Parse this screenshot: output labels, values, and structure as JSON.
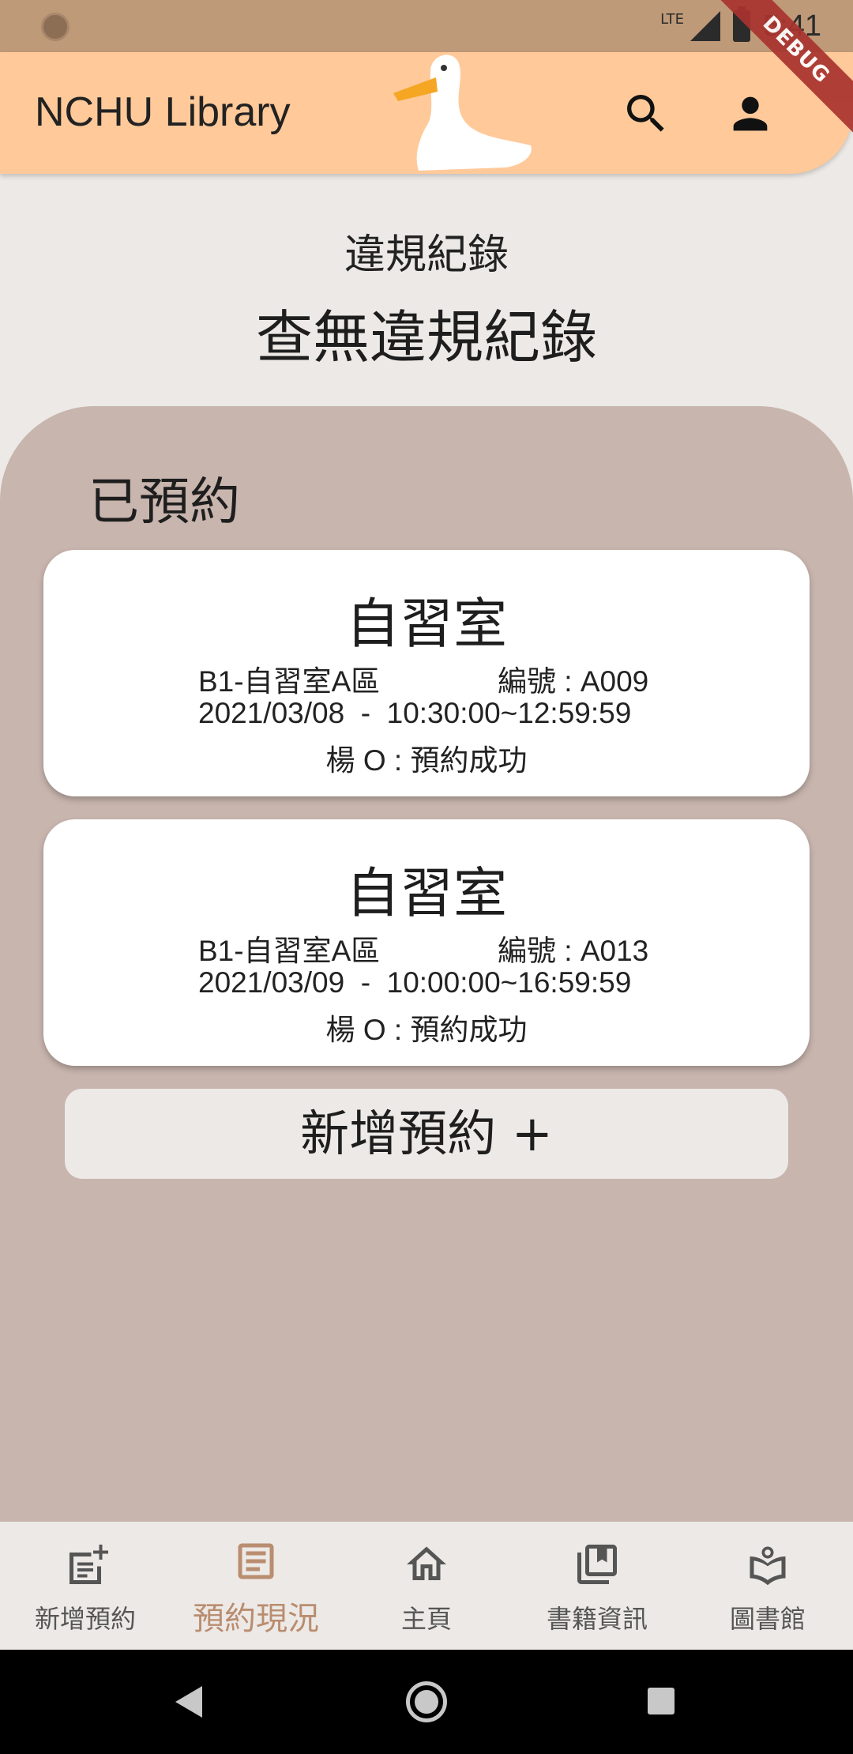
{
  "status_bar": {
    "network": "LTE",
    "time": "5:41"
  },
  "app_bar": {
    "title": "NCHU Library",
    "debug_label": "DEBUG",
    "search_icon": "search-icon",
    "account_icon": "person-icon"
  },
  "violation": {
    "label": "違規紀錄",
    "status": "查無違規紀錄"
  },
  "reserved": {
    "heading": "已預約",
    "cards": [
      {
        "title": "自習室",
        "location": "B1-自習室A區",
        "seat": "編號 : A009",
        "datetime": "2021/03/08  -  10:30:00~12:59:59",
        "status": "楊 O : 預約成功"
      },
      {
        "title": "自習室",
        "location": "B1-自習室A區",
        "seat": "編號 : A013",
        "datetime": "2021/03/09  -  10:00:00~16:59:59",
        "status": "楊 O : 預約成功"
      }
    ],
    "add_button": "新增預約 +"
  },
  "bottom_nav": {
    "items": [
      {
        "label": "新增預約",
        "icon": "add-note-icon",
        "active": false
      },
      {
        "label": "預約現況",
        "icon": "article-icon",
        "active": true
      },
      {
        "label": "主頁",
        "icon": "home-icon",
        "active": false
      },
      {
        "label": "書籍資訊",
        "icon": "library-books-icon",
        "active": false
      },
      {
        "label": "圖書館",
        "icon": "local-library-icon",
        "active": false
      }
    ]
  },
  "colors": {
    "status_bar": "#BF9A78",
    "app_bar": "#FFC999",
    "panel": "#C8B5AE",
    "background": "#ECE9E6",
    "active_nav": "#B98D70",
    "inactive_nav": "#555555"
  }
}
